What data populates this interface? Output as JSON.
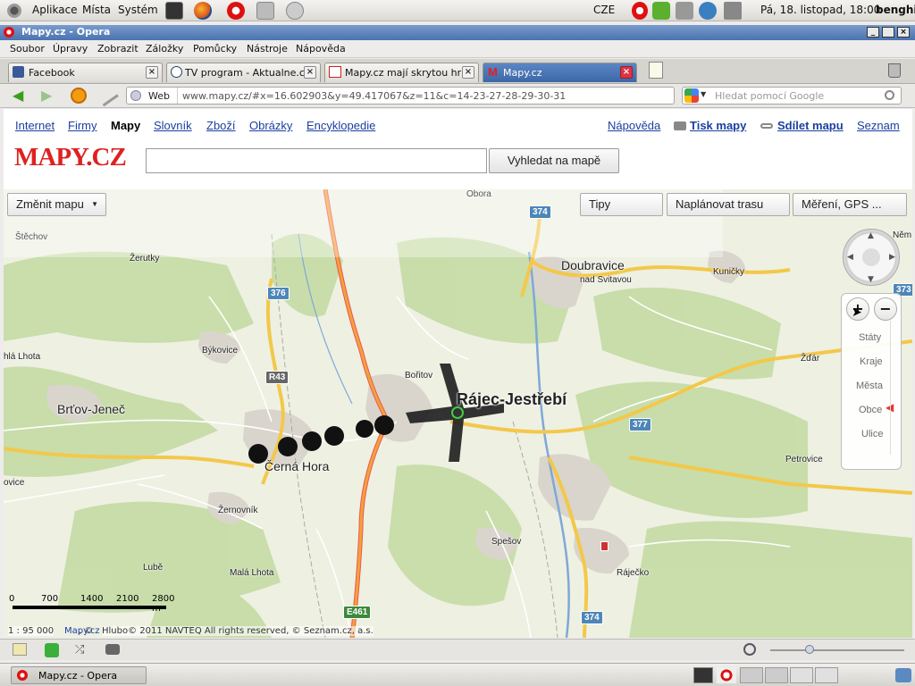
{
  "panel": {
    "menus": [
      "Aplikace",
      "Místa",
      "Systém"
    ],
    "keyboard": "CZE",
    "datetime": "Pá, 18. listopad, 18:00",
    "user": "benghi"
  },
  "window": {
    "title": "Mapy.cz - Opera"
  },
  "menubar": [
    "Soubor",
    "Úpravy",
    "Zobrazit",
    "Záložky",
    "Pomůcky",
    "Nástroje",
    "Nápověda"
  ],
  "tabs": [
    {
      "label": "Facebook"
    },
    {
      "label": "TV program - Aktualne.c..."
    },
    {
      "label": "Mapy.cz mají skrytou hr..."
    },
    {
      "label": "Mapy.cz"
    }
  ],
  "address": {
    "web_label": "Web",
    "url": "www.mapy.cz/#x=16.602903&y=49.417067&z=11&c=14-23-27-28-29-30-31",
    "search_placeholder": "Hledat pomocí Google"
  },
  "site": {
    "nav": [
      "Internet",
      "Firmy",
      "Mapy",
      "Slovník",
      "Zboží",
      "Obrázky",
      "Encyklopedie"
    ],
    "right_links": {
      "help": "Nápověda",
      "print": "Tisk mapy",
      "share": "Sdílet mapu",
      "seznam": "Seznam"
    },
    "logo": "MAPY.CZ",
    "search_button": "Vyhledat na mapě"
  },
  "map_controls": {
    "change_map": "Změnit mapu",
    "tips": "Tipy",
    "plan_route": "Naplánovat trasu",
    "measure": "Měření, GPS ...",
    "zoom_in": "+",
    "zoom_out": "−",
    "zoom_levels": [
      "Státy",
      "Kraje",
      "Města",
      "Obce",
      "Ulice"
    ]
  },
  "places": {
    "stechov": "Štěchov",
    "obora": "Obora",
    "nem": "Něm",
    "zerutky": "Žerutky",
    "doubravice": "Doubravice",
    "nad_svitavou": "nad Svitavou",
    "kunicky": "Kuničky",
    "bykovice": "Býkovice",
    "lhota": "hlá Lhota",
    "brtov": "Brťov-Jeneč",
    "boritov": "Bořitov",
    "rajec": "Rájec-Jestřebí",
    "zdar": "Žďár",
    "cerna_hora": "Černá Hora",
    "ovice": "ovice",
    "petrovice": "Petrovice",
    "zernovnik": "Žernovník",
    "spesov": "Spešov",
    "lube": "Lubě",
    "mala_lhota": "Malá Lhota",
    "rajecko": "Ráječko"
  },
  "roads": {
    "r374a": "374",
    "r376": "376",
    "r373": "373",
    "r43": "R43",
    "r377": "377",
    "r374b": "374",
    "e461": "E461"
  },
  "scale": {
    "ticks": [
      "0",
      "700",
      "1400",
      "2100",
      "2800 m"
    ],
    "ratio": "1 : 95 000",
    "copyright_link": "Mapy.cz",
    "copyright": "Hlubo© 2011 NAVTEQ All rights reserved, © Seznam.cz, a.s."
  },
  "taskbar": {
    "window": "Mapy.cz - Opera"
  }
}
